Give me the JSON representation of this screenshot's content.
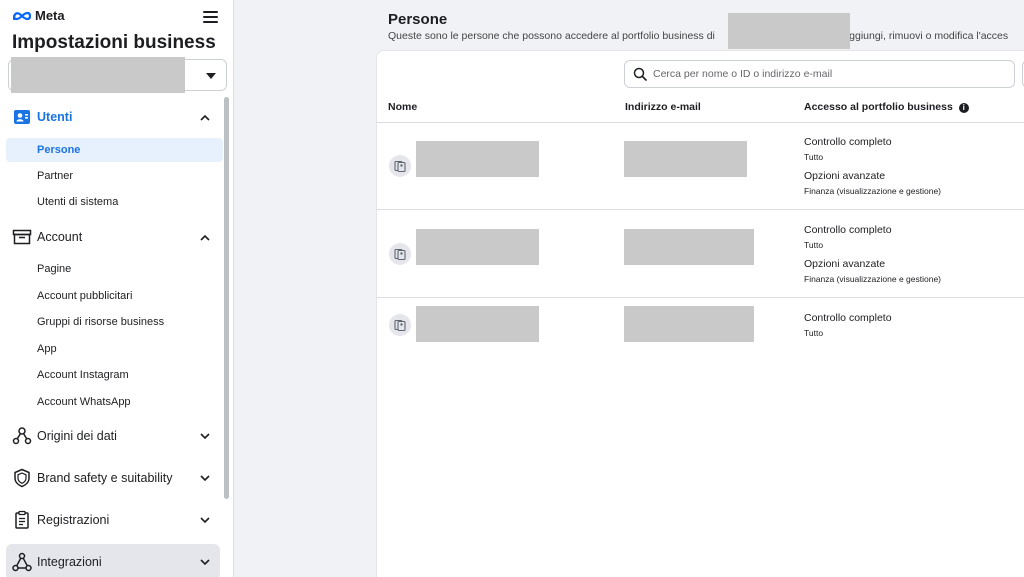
{
  "brand": {
    "name": "Meta",
    "accent": "#1b74e4"
  },
  "sidebar": {
    "title": "Impostazioni business",
    "sections": [
      {
        "label": "Utenti",
        "icon": "users-badge-icon",
        "expanded": true,
        "active": true,
        "items": [
          {
            "label": "Persone",
            "selected": true
          },
          {
            "label": "Partner"
          },
          {
            "label": "Utenti di sistema"
          }
        ]
      },
      {
        "label": "Account",
        "icon": "inbox-icon",
        "expanded": true,
        "items": [
          {
            "label": "Pagine"
          },
          {
            "label": "Account pubblicitari"
          },
          {
            "label": "Gruppi di risorse business"
          },
          {
            "label": "App"
          },
          {
            "label": "Account Instagram"
          },
          {
            "label": "Account WhatsApp"
          }
        ]
      },
      {
        "label": "Origini dei dati",
        "icon": "data-sources-icon",
        "expanded": false
      },
      {
        "label": "Brand safety e suitability",
        "icon": "shield-icon",
        "expanded": false
      },
      {
        "label": "Registrazioni",
        "icon": "clipboard-icon",
        "expanded": false
      },
      {
        "label": "Integrazioni",
        "icon": "integrations-icon",
        "expanded": false
      }
    ]
  },
  "main": {
    "title": "Persone",
    "description_before": "Queste sono le persone che possono accedere al portfolio business di",
    "description_after": ". Aggiungi, rimuovi o modifica l'acces",
    "search_placeholder": "Cerca per nome o ID o indirizzo e-mail",
    "columns": {
      "name": "Nome",
      "email": "Indirizzo e-mail",
      "access": "Accesso al portfolio business",
      "info_glyph": "i"
    },
    "rows": [
      {
        "access": [
          {
            "title": "Controllo completo",
            "detail": "Tutto"
          },
          {
            "title": "Opzioni avanzate",
            "detail": "Finanza (visualizzazione e gestione)"
          }
        ]
      },
      {
        "access": [
          {
            "title": "Controllo completo",
            "detail": "Tutto"
          },
          {
            "title": "Opzioni avanzate",
            "detail": "Finanza (visualizzazione e gestione)"
          }
        ]
      },
      {
        "access": [
          {
            "title": "Controllo completo",
            "detail": "Tutto"
          }
        ]
      }
    ]
  }
}
